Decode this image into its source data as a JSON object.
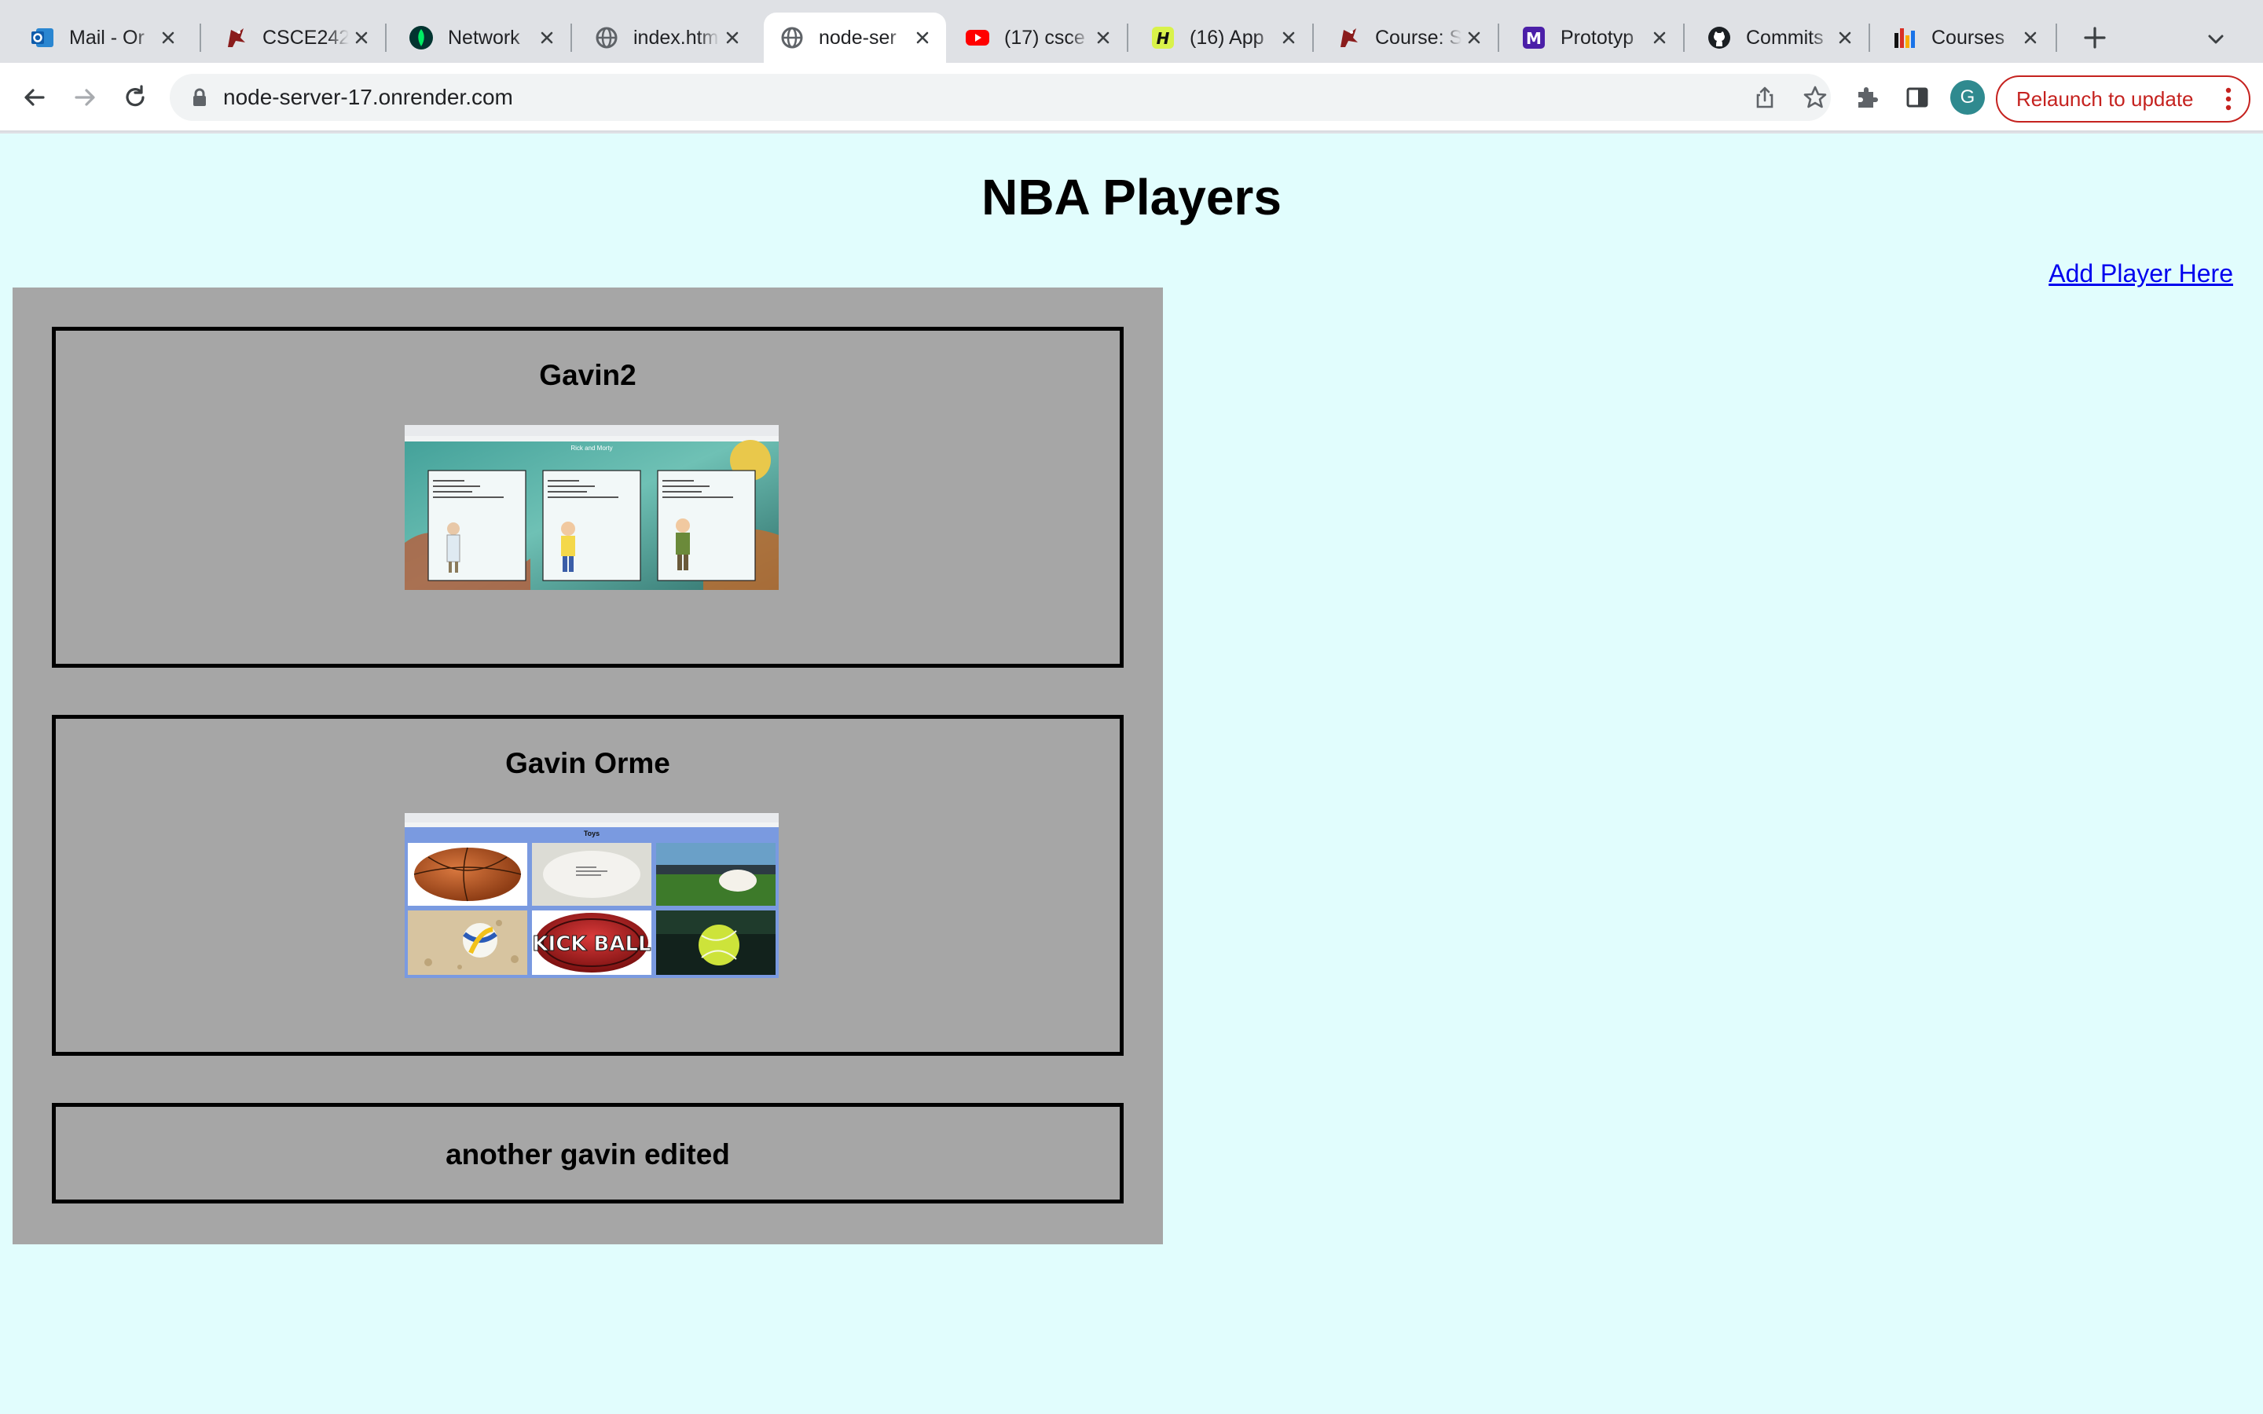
{
  "browser": {
    "tabs": [
      {
        "title": "Mail - Or",
        "icon": "outlook-icon"
      },
      {
        "title": "CSCE242",
        "icon": "gamecock-icon"
      },
      {
        "title": "Network",
        "icon": "mongodb-leaf-icon"
      },
      {
        "title": "index.htm",
        "icon": "globe-icon"
      },
      {
        "title": "node-ser",
        "icon": "globe-icon",
        "active": true
      },
      {
        "title": "(17) csce",
        "icon": "youtube-icon"
      },
      {
        "title": "(16) App",
        "icon": "h-badge-icon"
      },
      {
        "title": "Course: S",
        "icon": "gamecock-icon"
      },
      {
        "title": "Prototyp",
        "icon": "m-logo-icon"
      },
      {
        "title": "Commits",
        "icon": "github-icon"
      },
      {
        "title": "Courses",
        "icon": "bar-chart-icon"
      }
    ],
    "url": "node-server-17.onrender.com",
    "profile_initial": "G",
    "relaunch_label": "Relaunch to update",
    "accent_color": "#c5221f"
  },
  "page": {
    "title": "NBA Players",
    "add_link": "Add Player Here",
    "background": "#e1fdfd",
    "panel_color": "#a6a6a6",
    "players": [
      {
        "name": "Gavin2",
        "image": "rick-and-morty-screenshot",
        "image_text": {
          "heading": "Rick and Morty"
        }
      },
      {
        "name": "Gavin Orme",
        "image": "toys-screenshot",
        "image_text": {
          "heading": "Toys",
          "ball_label": "KICK BALL"
        }
      },
      {
        "name": "another gavin edited"
      }
    ]
  }
}
